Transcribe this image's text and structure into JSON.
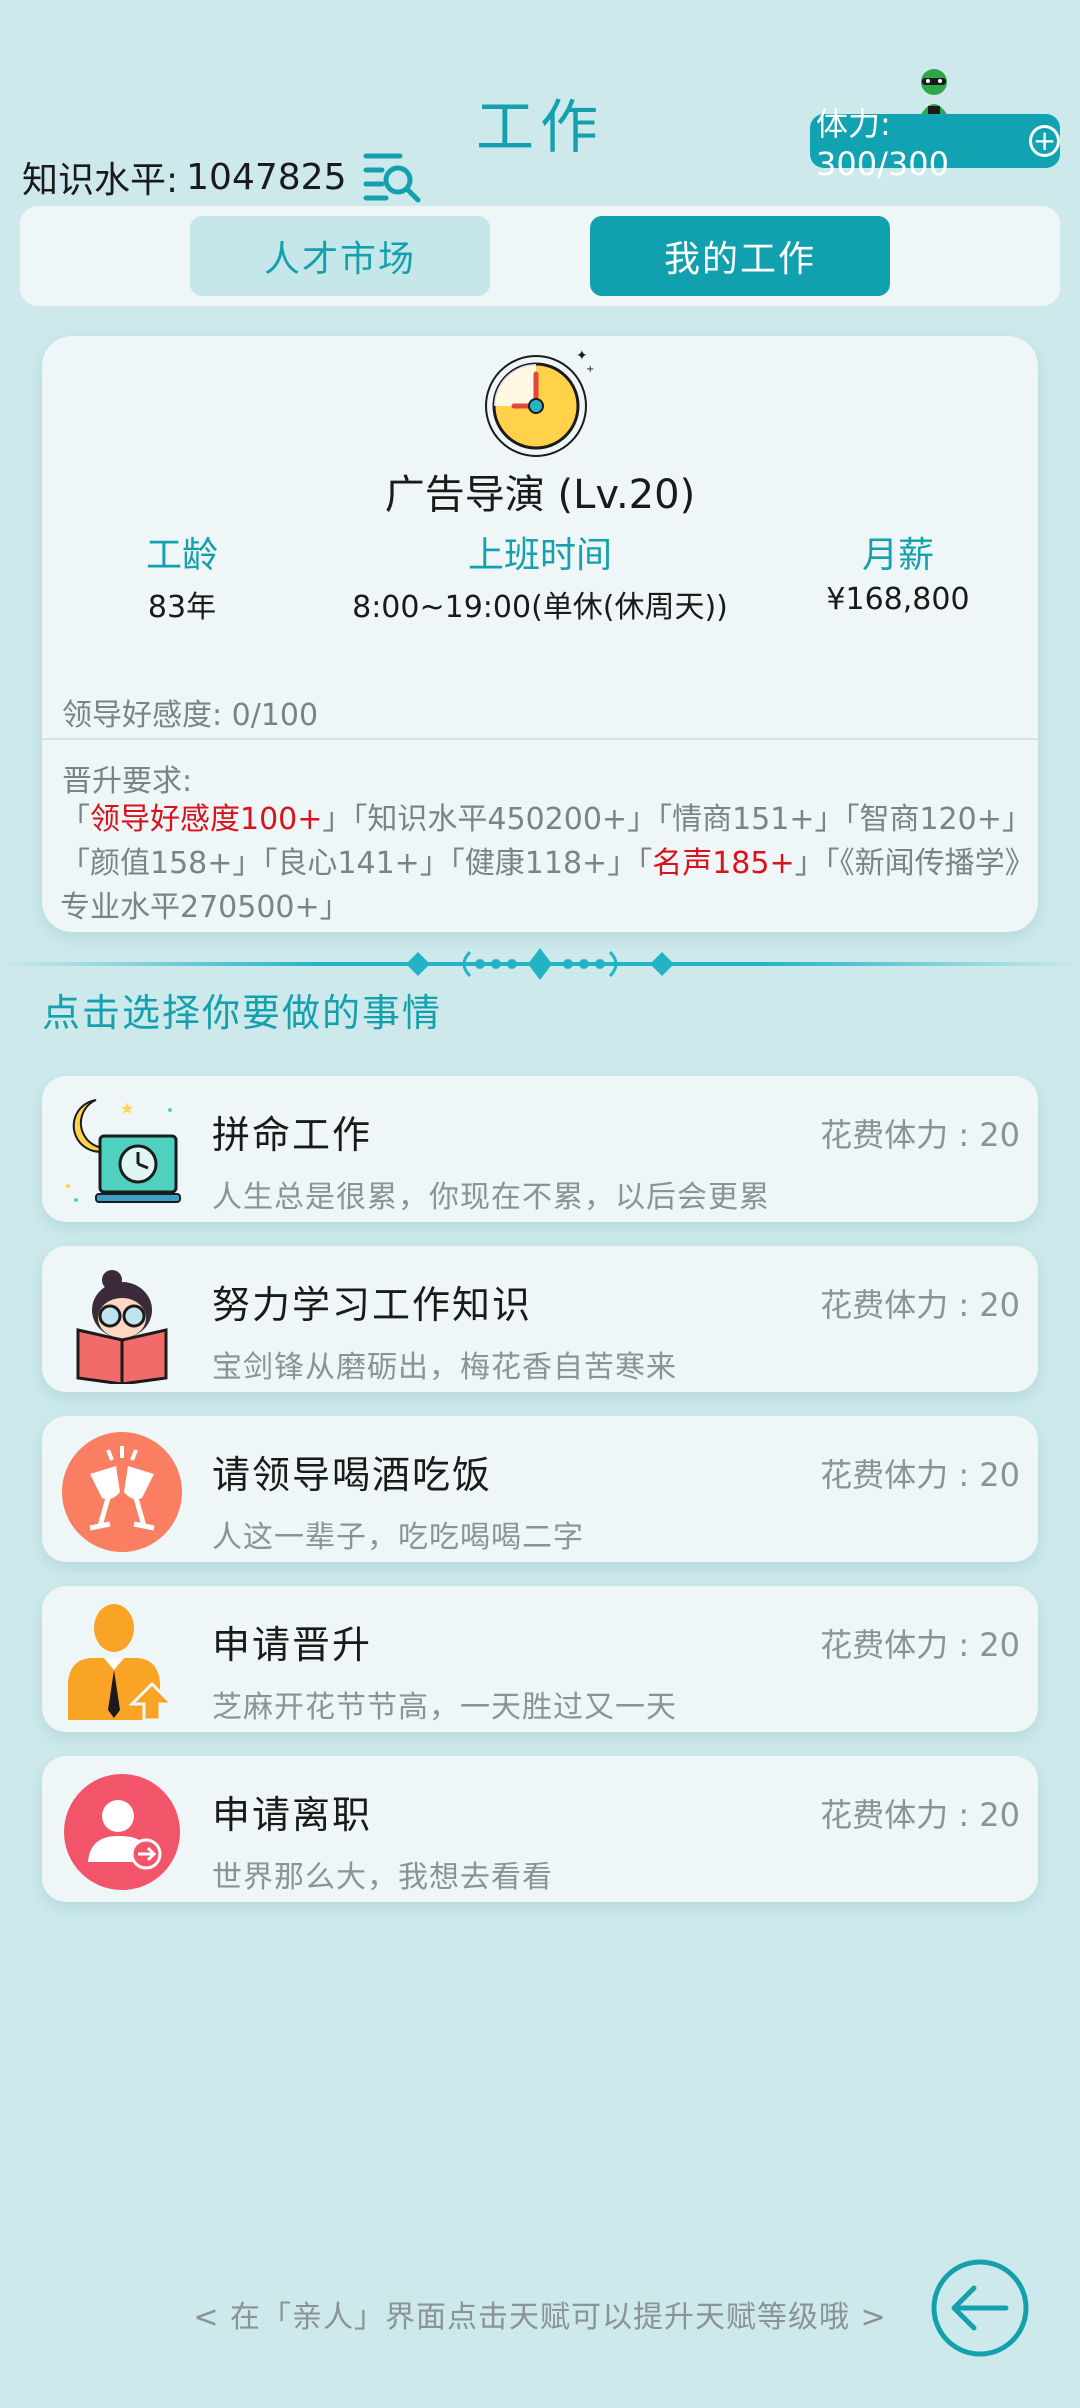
{
  "header": {
    "title": "工作",
    "knowledge_label": "知识水平:",
    "knowledge_value": "1047825",
    "stamina_text": "体力: 300/300"
  },
  "tabs": [
    {
      "label": "人才市场"
    },
    {
      "label": "我的工作"
    }
  ],
  "job": {
    "title": "广告导演 (Lv.20)",
    "stats": [
      {
        "label": "工龄",
        "value": "83年"
      },
      {
        "label": "上班时间",
        "value": "8:00~19:00(单休(休周天))"
      },
      {
        "label": "月薪",
        "value": "¥168,800"
      }
    ],
    "favor": "领导好感度: 0/100",
    "requirements_label": "晋升要求:",
    "requirements": [
      {
        "text": "「",
        "red": false
      },
      {
        "text": "领导好感度100+",
        "red": true
      },
      {
        "text": "」「知识水平450200+」「情商151+」「智商120+」「颜值158+」「良心141+」「健康118+」「",
        "red": false
      },
      {
        "text": "名声185+",
        "red": true
      },
      {
        "text": "」「《新闻传播学》专业水平270500+」",
        "red": false
      }
    ]
  },
  "choose_label": "点击选择你要做的事情",
  "actions": [
    {
      "name": "拼命工作",
      "desc": "人生总是很累，你现在不累，以后会更累",
      "cost": "花费体力 : 20",
      "icon": "night-work-icon"
    },
    {
      "name": "努力学习工作知识",
      "desc": "宝剑锋从磨砺出，梅花香自苦寒来",
      "cost": "花费体力 : 20",
      "icon": "study-icon"
    },
    {
      "name": "请领导喝酒吃饭",
      "desc": "人这一辈子，吃吃喝喝二字",
      "cost": "花费体力 : 20",
      "icon": "cheers-icon"
    },
    {
      "name": "申请晋升",
      "desc": "芝麻开花节节高，一天胜过又一天",
      "cost": "花费体力 : 20",
      "icon": "promotion-icon"
    },
    {
      "name": "申请离职",
      "desc": "世界那么大，我想去看看",
      "cost": "花费体力 : 20",
      "icon": "resign-icon"
    }
  ],
  "footer_tip": "< 在「亲人」界面点击天赋可以提升天赋等级哦 >",
  "colors": {
    "accent": "#14a1ad",
    "background": "#cde9ec",
    "card": "#eef6f7",
    "highlight": "#d9121c"
  }
}
